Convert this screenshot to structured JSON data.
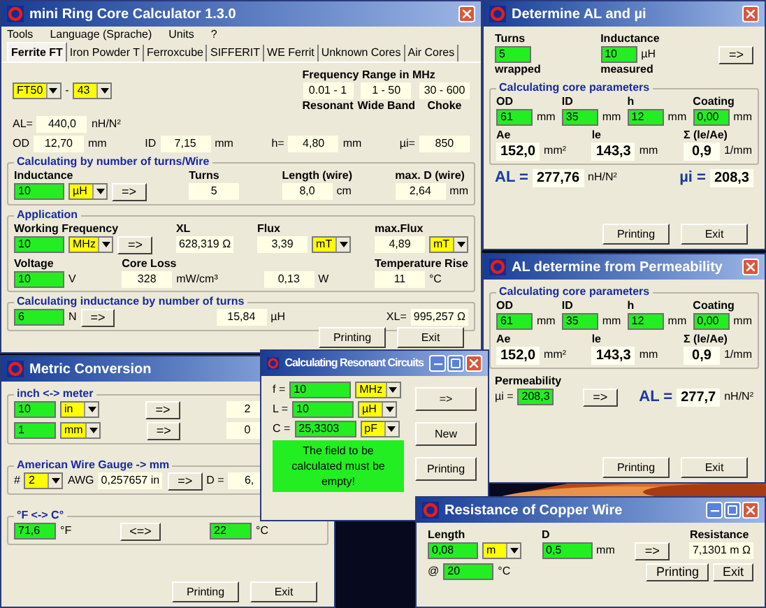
{
  "windows": [
    {
      "title": "mini Ring Core Calculator 1.3.0",
      "controls": [
        {
          "kind": "close"
        }
      ],
      "menu": [
        "Tools",
        "Language (Sprache)",
        "Units",
        "?"
      ],
      "tabs": [
        {
          "label": "Ferrite FT",
          "selected": true
        },
        {
          "label": "Iron Powder T",
          "selected": false
        },
        {
          "label": "Ferroxcube",
          "selected": false
        },
        {
          "label": "SIFFERIT",
          "selected": false
        },
        {
          "label": "WE Ferrit",
          "selected": false
        },
        {
          "label": "Unknown Cores",
          "selected": false
        },
        {
          "label": "Air Cores",
          "selected": false
        }
      ],
      "sections": [
        {
          "lines": [
            {
              "fields": [
                {
                  "items": [
                    {
                      "kind": "select",
                      "value": "FT50"
                    },
                    {
                      "kind": "text",
                      "value": "-"
                    },
                    {
                      "kind": "select",
                      "value": "43"
                    }
                  ]
                },
                {
                  "label": "Frequency Range in MHz",
                  "items": [
                    {
                      "kind": "output",
                      "value": "0.01 - 1",
                      "caption": "Resonant"
                    },
                    {
                      "kind": "output",
                      "value": "1 - 50",
                      "caption": "Wide Band"
                    },
                    {
                      "kind": "output",
                      "value": "30 - 600",
                      "caption": "Choke"
                    }
                  ]
                }
              ]
            },
            {
              "fields": [
                {
                  "items": [
                    {
                      "kind": "text",
                      "value": "AL="
                    },
                    {
                      "kind": "output",
                      "value": "440,0"
                    },
                    {
                      "kind": "text",
                      "value": "nH/N²"
                    }
                  ]
                }
              ]
            },
            {
              "fields": [
                {
                  "items": [
                    {
                      "kind": "text",
                      "value": "OD"
                    },
                    {
                      "kind": "output",
                      "value": "12,70"
                    },
                    {
                      "kind": "text",
                      "value": "mm"
                    }
                  ]
                },
                {
                  "items": [
                    {
                      "kind": "text",
                      "value": "ID"
                    },
                    {
                      "kind": "output",
                      "value": "7,15"
                    },
                    {
                      "kind": "text",
                      "value": "mm"
                    }
                  ]
                },
                {
                  "items": [
                    {
                      "kind": "text",
                      "value": "h="
                    },
                    {
                      "kind": "output",
                      "value": "4,80"
                    },
                    {
                      "kind": "text",
                      "value": "mm"
                    }
                  ]
                },
                {
                  "items": [
                    {
                      "kind": "text",
                      "value": "µi="
                    },
                    {
                      "kind": "output",
                      "value": "850"
                    }
                  ]
                }
              ]
            }
          ]
        },
        {
          "legend": "Calculating by number of turns/Wire",
          "lines": [
            {
              "fields": [
                {
                  "label": "Inductance",
                  "items": [
                    {
                      "kind": "input",
                      "value": "10"
                    },
                    {
                      "kind": "select",
                      "value": "µH"
                    },
                    {
                      "kind": "button",
                      "value": "=>"
                    }
                  ]
                },
                {
                  "label": "Turns",
                  "items": [
                    {
                      "kind": "output",
                      "value": "5"
                    }
                  ]
                },
                {
                  "label": "Length (wire)",
                  "items": [
                    {
                      "kind": "output",
                      "value": "8,0"
                    },
                    {
                      "kind": "text",
                      "value": "cm"
                    }
                  ]
                },
                {
                  "label": "max. D (wire)",
                  "items": [
                    {
                      "kind": "output",
                      "value": "2,64"
                    },
                    {
                      "kind": "text",
                      "value": "mm"
                    }
                  ]
                }
              ]
            }
          ]
        },
        {
          "legend": "Application",
          "lines": [
            {
              "fields": [
                {
                  "label": "Working Frequency",
                  "items": [
                    {
                      "kind": "input",
                      "value": "10"
                    },
                    {
                      "kind": "select",
                      "value": "MHz"
                    },
                    {
                      "kind": "button",
                      "value": "=>"
                    }
                  ]
                },
                {
                  "label": "XL",
                  "items": [
                    {
                      "kind": "output",
                      "value": "628,319 Ω"
                    }
                  ]
                },
                {
                  "label": "Flux",
                  "items": [
                    {
                      "kind": "output",
                      "value": "3,39"
                    },
                    {
                      "kind": "select",
                      "value": "mT"
                    }
                  ]
                },
                {
                  "label": "max.Flux",
                  "items": [
                    {
                      "kind": "output",
                      "value": "4,89"
                    },
                    {
                      "kind": "select",
                      "value": "mT"
                    }
                  ]
                }
              ]
            },
            {
              "fields": [
                {
                  "label": "Voltage",
                  "items": [
                    {
                      "kind": "input",
                      "value": "10"
                    },
                    {
                      "kind": "text",
                      "value": "V"
                    }
                  ]
                },
                {
                  "label": "Core Loss",
                  "items": [
                    {
                      "kind": "output",
                      "value": "328"
                    },
                    {
                      "kind": "text",
                      "value": "mW/cm³"
                    }
                  ]
                },
                {
                  "items": [
                    {
                      "kind": "output",
                      "value": "0,13"
                    },
                    {
                      "kind": "text",
                      "value": "W"
                    }
                  ]
                },
                {
                  "label": "Temperature Rise",
                  "items": [
                    {
                      "kind": "output",
                      "value": "11"
                    },
                    {
                      "kind": "text",
                      "value": "°C"
                    }
                  ]
                }
              ]
            }
          ]
        },
        {
          "legend": "Calculating inductance by number of turns",
          "lines": [
            {
              "fields": [
                {
                  "items": [
                    {
                      "kind": "input",
                      "value": "6"
                    },
                    {
                      "kind": "text",
                      "value": "N"
                    },
                    {
                      "kind": "button",
                      "value": "=>"
                    }
                  ]
                },
                {
                  "items": [
                    {
                      "kind": "output",
                      "value": "15,84"
                    },
                    {
                      "kind": "text",
                      "value": "µH"
                    }
                  ]
                },
                {
                  "items": [
                    {
                      "kind": "text",
                      "value": "XL="
                    },
                    {
                      "kind": "output",
                      "value": "995,257 Ω"
                    }
                  ]
                }
              ]
            }
          ]
        }
      ],
      "footer": [
        "Printing",
        "Exit"
      ]
    },
    {
      "title": "Determine AL and µi",
      "controls": [
        {
          "kind": "close"
        }
      ],
      "sections": [
        {
          "lines": [
            {
              "fields": [
                {
                  "label": "Turns",
                  "items": [
                    {
                      "kind": "input",
                      "value": "5"
                    }
                  ],
                  "caption": "wrapped"
                },
                {
                  "label": "Inductance",
                  "items": [
                    {
                      "kind": "input",
                      "value": "10"
                    },
                    {
                      "kind": "text",
                      "value": "µH"
                    }
                  ],
                  "caption": "measured"
                },
                {
                  "items": [
                    {
                      "kind": "button",
                      "value": "=>"
                    }
                  ]
                }
              ]
            }
          ]
        },
        {
          "legend": "Calculating core parameters",
          "lines": [
            {
              "fields": [
                {
                  "label": "OD",
                  "items": [
                    {
                      "kind": "input",
                      "value": "61"
                    },
                    {
                      "kind": "text",
                      "value": "mm"
                    }
                  ]
                },
                {
                  "label": "ID",
                  "items": [
                    {
                      "kind": "input",
                      "value": "35"
                    },
                    {
                      "kind": "text",
                      "value": "mm"
                    }
                  ]
                },
                {
                  "label": "h",
                  "items": [
                    {
                      "kind": "input",
                      "value": "12"
                    },
                    {
                      "kind": "text",
                      "value": "mm"
                    }
                  ]
                },
                {
                  "label": "Coating",
                  "items": [
                    {
                      "kind": "input",
                      "value": "0,00"
                    },
                    {
                      "kind": "text",
                      "value": "mm"
                    }
                  ]
                }
              ]
            },
            {
              "fields": [
                {
                  "label": "Ae",
                  "items": [
                    {
                      "kind": "result",
                      "value": "152,0"
                    },
                    {
                      "kind": "text",
                      "value": "mm²"
                    }
                  ]
                },
                {
                  "label": "le",
                  "items": [
                    {
                      "kind": "result",
                      "value": "143,3"
                    },
                    {
                      "kind": "text",
                      "value": "mm"
                    }
                  ]
                },
                {
                  "label": "Σ (le/Ae)",
                  "items": [
                    {
                      "kind": "result",
                      "value": "0,9"
                    },
                    {
                      "kind": "text",
                      "value": "1/mm"
                    }
                  ]
                }
              ]
            }
          ]
        },
        {
          "lines": [
            {
              "fields": [
                {
                  "items": [
                    {
                      "kind": "emph",
                      "value": "AL ="
                    },
                    {
                      "kind": "result",
                      "value": "277,76"
                    },
                    {
                      "kind": "text",
                      "value": "nH/N²"
                    }
                  ]
                },
                {
                  "items": [
                    {
                      "kind": "emph",
                      "value": "µi ="
                    },
                    {
                      "kind": "result",
                      "value": "208,3"
                    }
                  ]
                }
              ]
            }
          ]
        }
      ],
      "footer": [
        "Printing",
        "Exit"
      ]
    },
    {
      "title": "AL determine from Permeability",
      "controls": [
        {
          "kind": "close"
        }
      ],
      "sections": [
        {
          "legend": "Calculating core parameters",
          "lines": [
            {
              "fields": [
                {
                  "label": "OD",
                  "items": [
                    {
                      "kind": "input",
                      "value": "61"
                    },
                    {
                      "kind": "text",
                      "value": "mm"
                    }
                  ]
                },
                {
                  "label": "ID",
                  "items": [
                    {
                      "kind": "input",
                      "value": "35"
                    },
                    {
                      "kind": "text",
                      "value": "mm"
                    }
                  ]
                },
                {
                  "label": "h",
                  "items": [
                    {
                      "kind": "input",
                      "value": "12"
                    },
                    {
                      "kind": "text",
                      "value": "mm"
                    }
                  ]
                },
                {
                  "label": "Coating",
                  "items": [
                    {
                      "kind": "input",
                      "value": "0,00"
                    },
                    {
                      "kind": "text",
                      "value": "mm"
                    }
                  ]
                }
              ]
            },
            {
              "fields": [
                {
                  "label": "Ae",
                  "items": [
                    {
                      "kind": "result",
                      "value": "152,0"
                    },
                    {
                      "kind": "text",
                      "value": "mm²"
                    }
                  ]
                },
                {
                  "label": "le",
                  "items": [
                    {
                      "kind": "result",
                      "value": "143,3"
                    },
                    {
                      "kind": "text",
                      "value": "mm"
                    }
                  ]
                },
                {
                  "label": "Σ (le/Ae)",
                  "items": [
                    {
                      "kind": "result",
                      "value": "0,9"
                    },
                    {
                      "kind": "text",
                      "value": "1/mm"
                    }
                  ]
                }
              ]
            }
          ]
        },
        {
          "lines": [
            {
              "fields": [
                {
                  "label": "Permeability",
                  "items": [
                    {
                      "kind": "text",
                      "value": "µi ="
                    },
                    {
                      "kind": "input",
                      "value": "208,3"
                    }
                  ]
                },
                {
                  "items": [
                    {
                      "kind": "button",
                      "value": "=>"
                    }
                  ]
                },
                {
                  "items": [
                    {
                      "kind": "emph",
                      "value": "AL ="
                    },
                    {
                      "kind": "result",
                      "value": "277,7"
                    },
                    {
                      "kind": "text",
                      "value": "nH/N²"
                    }
                  ]
                }
              ]
            }
          ]
        }
      ],
      "footer": [
        "Printing",
        "Exit"
      ]
    },
    {
      "title": "Metric Conversion",
      "sections": [
        {
          "legend": "inch <-> meter",
          "lines": [
            {
              "fields": [
                {
                  "items": [
                    {
                      "kind": "input",
                      "value": "10"
                    },
                    {
                      "kind": "select",
                      "value": "in"
                    }
                  ]
                },
                {
                  "items": [
                    {
                      "kind": "button",
                      "value": "=>"
                    }
                  ]
                },
                {
                  "items": [
                    {
                      "kind": "output",
                      "value": "2"
                    }
                  ]
                }
              ]
            },
            {
              "fields": [
                {
                  "items": [
                    {
                      "kind": "input",
                      "value": "1"
                    },
                    {
                      "kind": "select",
                      "value": "mm"
                    }
                  ]
                },
                {
                  "items": [
                    {
                      "kind": "button",
                      "value": "=>"
                    }
                  ]
                },
                {
                  "items": [
                    {
                      "kind": "output",
                      "value": "0"
                    }
                  ]
                }
              ]
            }
          ]
        },
        {
          "legend": "American Wire Gauge -> mm",
          "lines": [
            {
              "fields": [
                {
                  "items": [
                    {
                      "kind": "text",
                      "value": "#"
                    },
                    {
                      "kind": "select",
                      "value": "2"
                    },
                    {
                      "kind": "text",
                      "value": "AWG"
                    },
                    {
                      "kind": "output",
                      "value": "0,257657 in"
                    }
                  ]
                },
                {
                  "items": [
                    {
                      "kind": "button",
                      "value": "=>"
                    },
                    {
                      "kind": "text",
                      "value": "D ="
                    },
                    {
                      "kind": "output",
                      "value": "6,"
                    }
                  ]
                }
              ]
            }
          ]
        },
        {
          "legend": "°F <-> C°",
          "lines": [
            {
              "fields": [
                {
                  "items": [
                    {
                      "kind": "input",
                      "value": "71,6"
                    },
                    {
                      "kind": "text",
                      "value": "°F"
                    }
                  ]
                },
                {
                  "items": [
                    {
                      "kind": "button",
                      "value": "<=>"
                    }
                  ]
                },
                {
                  "items": [
                    {
                      "kind": "input",
                      "value": "22"
                    },
                    {
                      "kind": "text",
                      "value": "°C"
                    }
                  ]
                }
              ]
            }
          ]
        }
      ],
      "footer": [
        "Printing",
        "Exit"
      ]
    },
    {
      "title": "Calculating Resonant Circuits",
      "controls": [
        {
          "kind": "minimize"
        },
        {
          "kind": "maximize"
        },
        {
          "kind": "close"
        }
      ],
      "sections": [
        {
          "lines": [
            {
              "fields": [
                {
                  "items": [
                    {
                      "kind": "text",
                      "value": "f ="
                    },
                    {
                      "kind": "input",
                      "value": "10"
                    },
                    {
                      "kind": "select",
                      "value": "MHz"
                    }
                  ]
                }
              ]
            },
            {
              "fields": [
                {
                  "items": [
                    {
                      "kind": "text",
                      "value": "L ="
                    },
                    {
                      "kind": "input",
                      "value": "10"
                    },
                    {
                      "kind": "select",
                      "value": "µH"
                    }
                  ]
                }
              ]
            },
            {
              "fields": [
                {
                  "items": [
                    {
                      "kind": "text",
                      "value": "C ="
                    },
                    {
                      "kind": "input",
                      "value": "25,3303"
                    },
                    {
                      "kind": "select",
                      "value": "pF"
                    }
                  ]
                }
              ]
            }
          ]
        }
      ],
      "message": "The field to be calculated must be empty!",
      "side_buttons": [
        "=>",
        "New",
        "Printing"
      ]
    },
    {
      "title": "Resistance of Copper Wire",
      "controls": [
        {
          "kind": "minimize"
        },
        {
          "kind": "maximize"
        },
        {
          "kind": "close"
        }
      ],
      "sections": [
        {
          "lines": [
            {
              "fields": [
                {
                  "label": "Length",
                  "items": [
                    {
                      "kind": "input",
                      "value": "0,08"
                    },
                    {
                      "kind": "select",
                      "value": "m"
                    }
                  ]
                },
                {
                  "label": "D",
                  "items": [
                    {
                      "kind": "input",
                      "value": "0,5"
                    },
                    {
                      "kind": "text",
                      "value": "mm"
                    }
                  ]
                },
                {
                  "items": [
                    {
                      "kind": "button",
                      "value": "=>"
                    }
                  ]
                },
                {
                  "label": "Resistance",
                  "items": [
                    {
                      "kind": "output",
                      "value": "7,1301 m Ω"
                    }
                  ]
                }
              ]
            },
            {
              "fields": [
                {
                  "items": [
                    {
                      "kind": "text",
                      "value": "@"
                    },
                    {
                      "kind": "input",
                      "value": "20"
                    },
                    {
                      "kind": "text",
                      "value": "°C"
                    }
                  ]
                },
                {
                  "items": [
                    {
                      "kind": "button",
                      "value": "Printing"
                    },
                    {
                      "kind": "button",
                      "value": "Exit"
                    }
                  ]
                }
              ]
            }
          ]
        }
      ]
    }
  ]
}
